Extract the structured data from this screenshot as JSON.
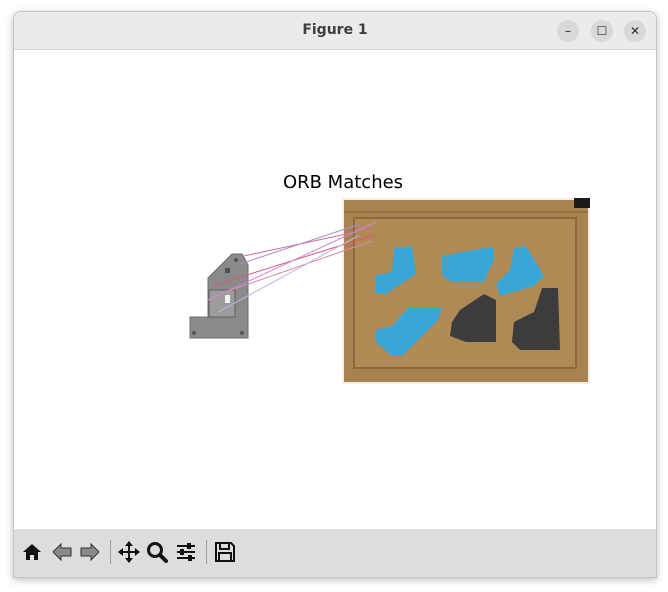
{
  "window": {
    "title": "Figure 1"
  },
  "controls": {
    "minimize": "–",
    "maximize": "☐",
    "close": "✕"
  },
  "figure": {
    "title": "ORB Matches"
  },
  "toolbar": {
    "buttons": [
      "home-icon",
      "back-icon",
      "forward-icon",
      "pan-icon",
      "zoom-icon",
      "configure-subplots-icon",
      "save-icon"
    ]
  },
  "colors": {
    "titlebar": "#ebebeb",
    "toolbar": "#dddddd",
    "crate": "#a8834f",
    "blue_parts": "#3aa6d6",
    "dark_parts": "#3c3c3c"
  }
}
